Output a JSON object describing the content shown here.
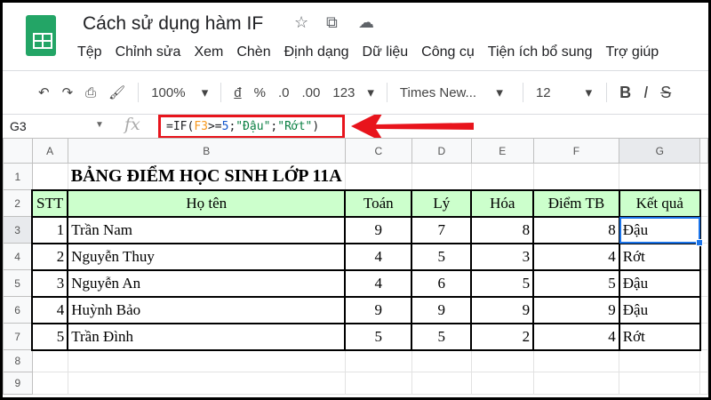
{
  "app": {
    "title": "Cách sử dụng hàm IF"
  },
  "menu": [
    "Tệp",
    "Chỉnh sửa",
    "Xem",
    "Chèn",
    "Định dạng",
    "Dữ liệu",
    "Công cụ",
    "Tiện ích bổ sung",
    "Trợ giúp"
  ],
  "toolbar": {
    "zoom": "100%",
    "currency": "đ",
    "percent": "%",
    "dec_less": ".0",
    "dec_more": ".00",
    "format_more": "123",
    "font": "Times New...",
    "font_size": "12",
    "bold": "B",
    "italic": "I",
    "strike": "S"
  },
  "formula_bar": {
    "cell_ref": "G3",
    "fx": "fx",
    "formula_parts": [
      "=IF(",
      "F3",
      ">=",
      "5",
      ";",
      "\"Đậu\"",
      ";",
      "\"Rớt\"",
      ")"
    ]
  },
  "colors": {
    "accent": "#e8141c",
    "header_fill": "#ccffcc",
    "selection": "#1a73e8"
  },
  "columns": [
    "A",
    "B",
    "C",
    "D",
    "E",
    "F",
    "G"
  ],
  "rows": [
    "1",
    "2",
    "3",
    "4",
    "5",
    "6",
    "7",
    "8",
    "9"
  ],
  "sheet": {
    "title": "BẢNG ĐIỂM HỌC SINH LỚP 11A",
    "headers": [
      "STT",
      "Họ tên",
      "Toán",
      "Lý",
      "Hóa",
      "Điểm TB",
      "Kết quả"
    ],
    "data": [
      [
        "1",
        "Trần Nam",
        "9",
        "7",
        "8",
        "8",
        "Đậu"
      ],
      [
        "2",
        "Nguyễn Thuy",
        "4",
        "5",
        "3",
        "4",
        "Rớt"
      ],
      [
        "3",
        "Nguyễn An",
        "4",
        "6",
        "5",
        "5",
        "Đậu"
      ],
      [
        "4",
        "Huỳnh Bảo",
        "9",
        "9",
        "9",
        "9",
        "Đậu"
      ],
      [
        "5",
        "Trần Đình",
        "5",
        "5",
        "2",
        "4",
        "Rớt"
      ]
    ]
  }
}
